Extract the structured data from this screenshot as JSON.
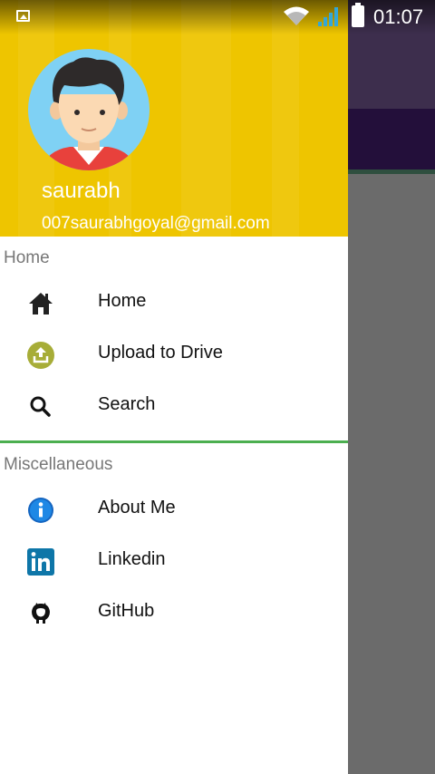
{
  "status_bar": {
    "time": "01:07",
    "icons": [
      "gallery-icon",
      "wifi-icon",
      "signal-icon",
      "battery-icon"
    ]
  },
  "drawer": {
    "header": {
      "name": "saurabh",
      "email": "007saurabhgoyal@gmail.com",
      "background_color": "#eec500"
    },
    "sections": [
      {
        "title": "Home",
        "items": [
          {
            "label": "Home",
            "icon": "home-icon"
          },
          {
            "label": "Upload to Drive",
            "icon": "upload-icon"
          },
          {
            "label": "Search",
            "icon": "search-icon"
          }
        ]
      },
      {
        "title": "Miscellaneous",
        "items": [
          {
            "label": "About Me",
            "icon": "info-icon"
          },
          {
            "label": "Linkedin",
            "icon": "linkedin-icon"
          },
          {
            "label": "GitHub",
            "icon": "github-icon"
          }
        ]
      }
    ],
    "divider_color": "#4caf50"
  },
  "background_app": {
    "toolbar_color": "#230f3a",
    "scrim_color": "#6b6b6b"
  }
}
